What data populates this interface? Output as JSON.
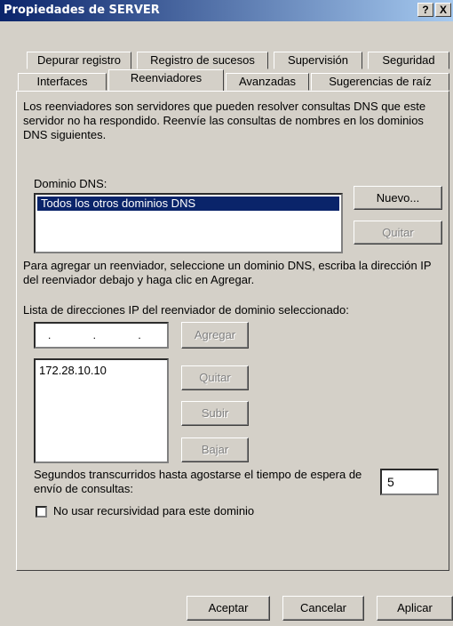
{
  "window": {
    "title": "Propiedades de SERVER",
    "help_label": "?",
    "close_label": "X"
  },
  "tabs_row1": [
    "Depurar registro",
    "Registro de sucesos",
    "Supervisión",
    "Seguridad"
  ],
  "tabs_row2": [
    "Interfaces",
    "Reenviadores",
    "Avanzadas",
    "Sugerencias de raíz"
  ],
  "panel": {
    "intro": "Los reenviadores son servidores que pueden resolver consultas DNS que este servidor no ha respondido. Reenvíe las consultas de nombres en los dominios DNS siguientes.",
    "dns_domain_label": "Dominio DNS:",
    "dns_domains": [
      "Todos los otros dominios DNS"
    ],
    "new_button": "Nuevo...",
    "remove_domain_button": "Quitar",
    "add_help": "Para agregar un reenviador, seleccione un dominio DNS, escriba la dirección IP del reenviador debajo y haga clic en Agregar.",
    "ip_list_label": "Lista de direcciones IP del reenviador de dominio seleccionado:",
    "ip_input_placeholder": ". . .",
    "add_button": "Agregar",
    "ip_addresses": [
      "172.28.10.10"
    ],
    "remove_ip_button": "Quitar",
    "up_button": "Subir",
    "down_button": "Bajar",
    "timeout_label": "Segundos transcurridos hasta agostarse el tiempo de espera de envío de consultas:",
    "timeout_value": "5",
    "no_recursion_label": "No usar recursividad para este dominio",
    "no_recursion_checked": false
  },
  "footer": {
    "ok": "Aceptar",
    "cancel": "Cancelar",
    "apply": "Aplicar"
  }
}
